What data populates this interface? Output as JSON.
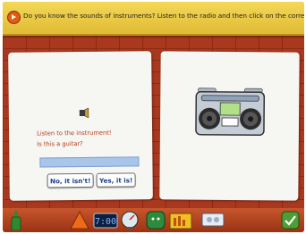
{
  "banner": {
    "instruction": "Do you know the sounds of instruments? Listen to the radio and then click on the correct button!",
    "sound_icon": "speaker-play-icon"
  },
  "question": {
    "prompt_line1": "Listen to the instrument!",
    "prompt_line2": "Is this a guitar?",
    "icon": "horn-icon",
    "answer_value": ""
  },
  "buttons": {
    "no_label": "No, it isn't!",
    "yes_label": "Yes, it is!"
  },
  "radio": {
    "icon": "radio-icon"
  },
  "toolbar": {
    "items": [
      "bottle-icon",
      "cone-icon",
      "clock-display-icon",
      "gauge-icon",
      "face-icon",
      "folder-icon",
      "tape-icon",
      "checkmark-icon"
    ]
  },
  "colors": {
    "banner": "#e8c642",
    "brick": "#a8381e",
    "prompt_text": "#b43a1c",
    "button_text": "#1d3d88",
    "answer_bar": "#a9c6ea",
    "ok_button": "#4f9e35"
  }
}
